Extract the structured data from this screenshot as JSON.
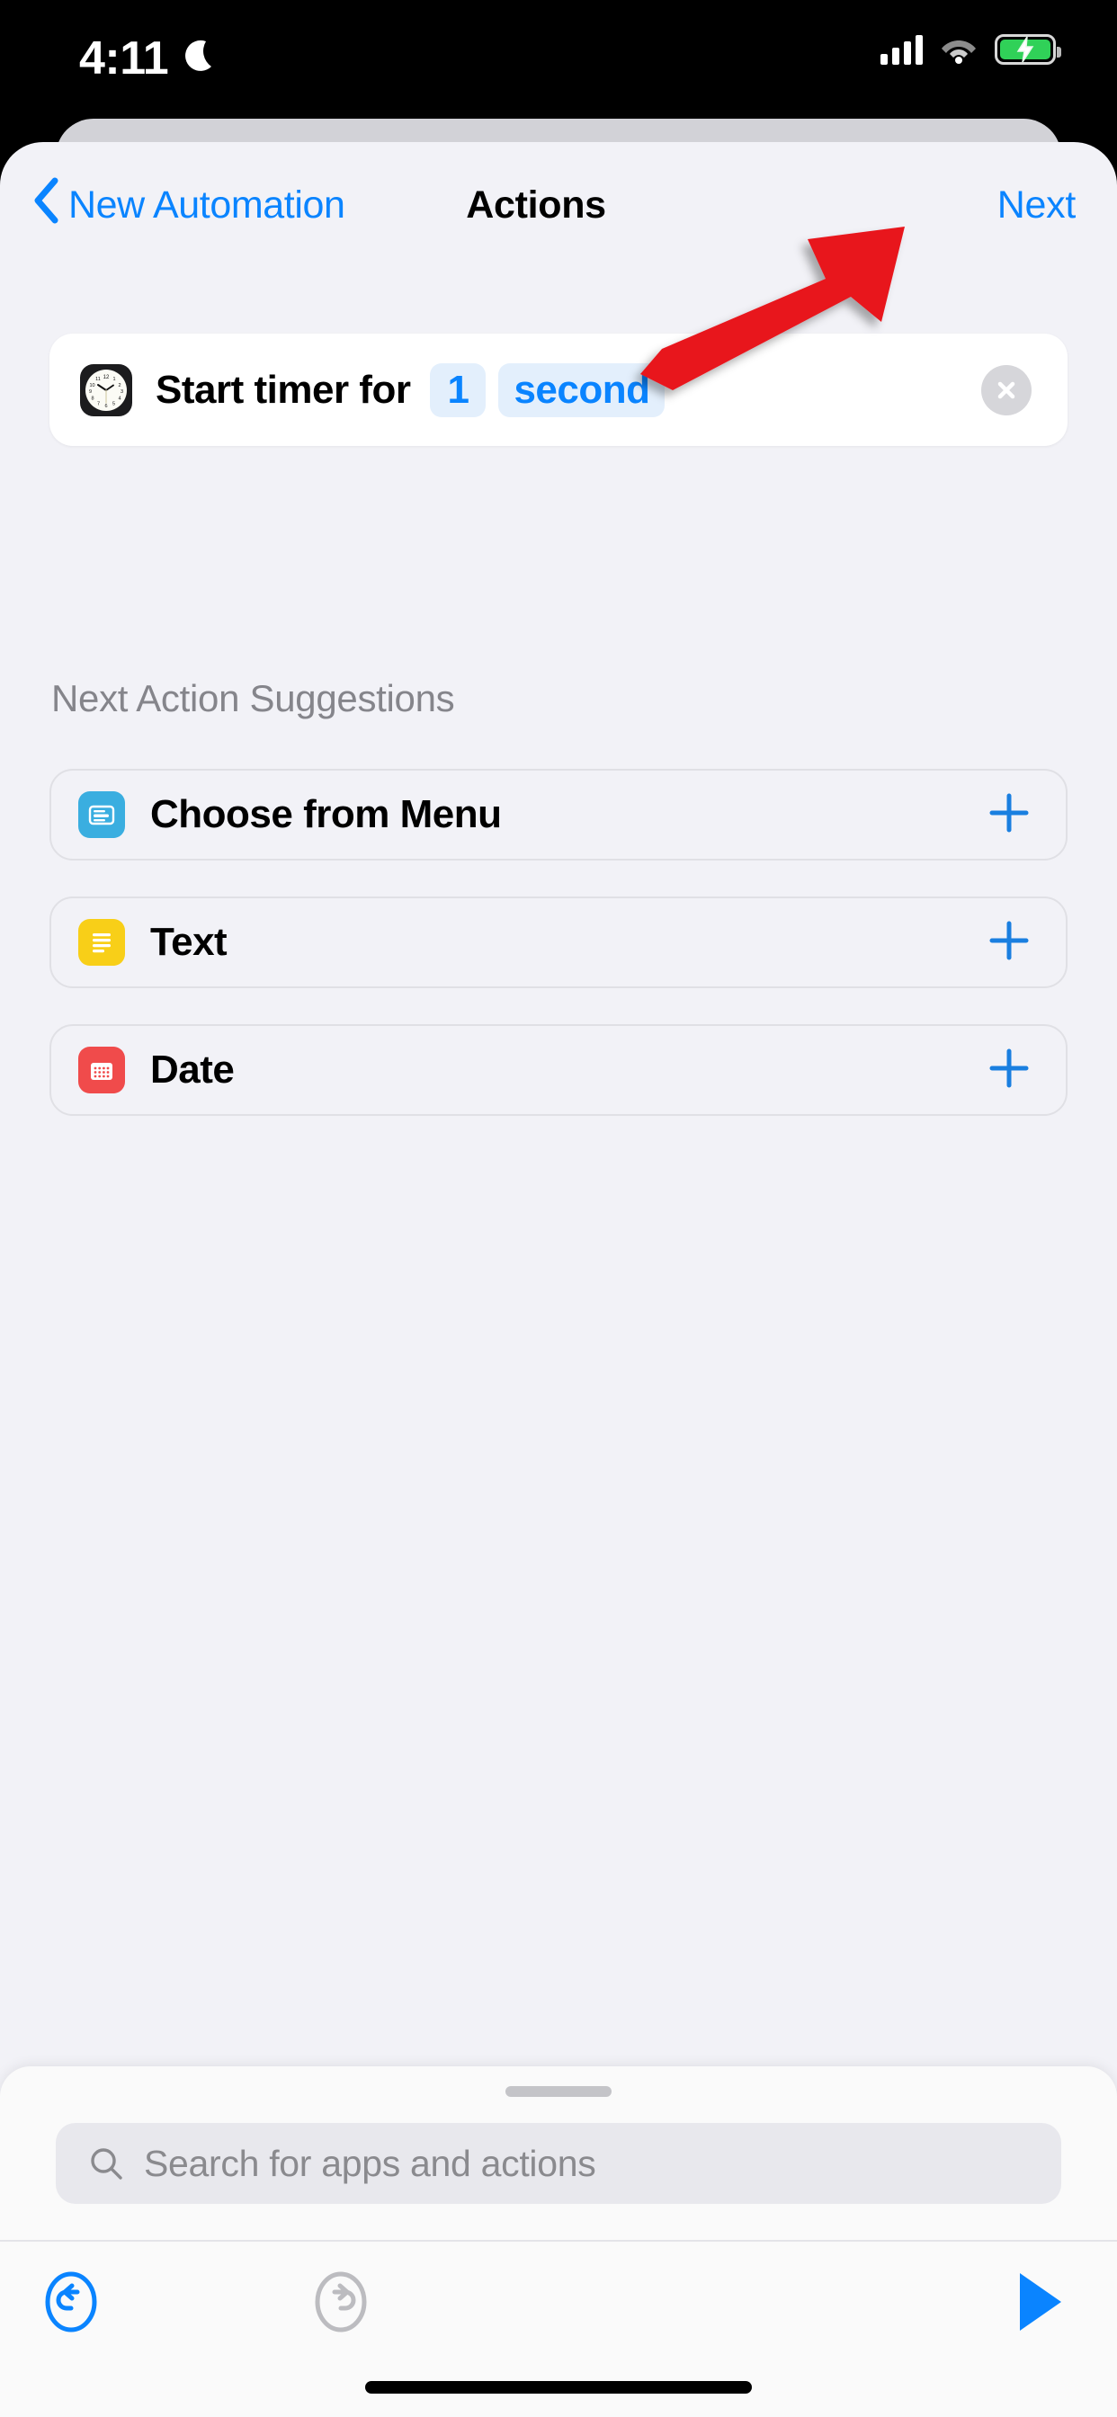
{
  "status_bar": {
    "time": "4:11",
    "dnd_icon": "moon-icon",
    "cellular_icon": "signal-bars-icon",
    "wifi_icon": "wifi-icon",
    "battery_icon": "battery-charging-icon",
    "battery_color": "#30d158"
  },
  "nav": {
    "back_label": "New Automation",
    "back_icon": "chevron-left-icon",
    "title": "Actions",
    "next_label": "Next",
    "accent_color": "#0a84ff"
  },
  "action": {
    "icon": "clock-icon",
    "text": "Start timer for",
    "value_token": "1",
    "unit_token": "second",
    "remove_icon": "close-circle-icon",
    "token_bg": "#e3effc",
    "token_color": "#0a84ff"
  },
  "suggestions": {
    "header": "Next Action Suggestions",
    "items": [
      {
        "label": "Choose from Menu",
        "icon": "menu-card-icon",
        "icon_color": "#3aaee0",
        "add_icon": "plus-icon"
      },
      {
        "label": "Text",
        "icon": "text-lines-icon",
        "icon_color": "#f8cf18",
        "add_icon": "plus-icon"
      },
      {
        "label": "Date",
        "icon": "calendar-icon",
        "icon_color": "#f04b4b",
        "add_icon": "plus-icon"
      }
    ]
  },
  "bottom_sheet": {
    "grabber": "drag-handle",
    "search_placeholder": "Search for apps and actions",
    "search_icon": "search-icon"
  },
  "toolbar": {
    "undo_icon": "undo-icon",
    "undo_enabled_color": "#0a84ff",
    "redo_icon": "redo-icon",
    "redo_disabled_color": "#bcbcc0",
    "run_icon": "play-icon",
    "run_color": "#0a84ff"
  },
  "annotation": {
    "arrow_icon": "red-arrow-pointing-to-next",
    "arrow_color": "#e8171f"
  }
}
